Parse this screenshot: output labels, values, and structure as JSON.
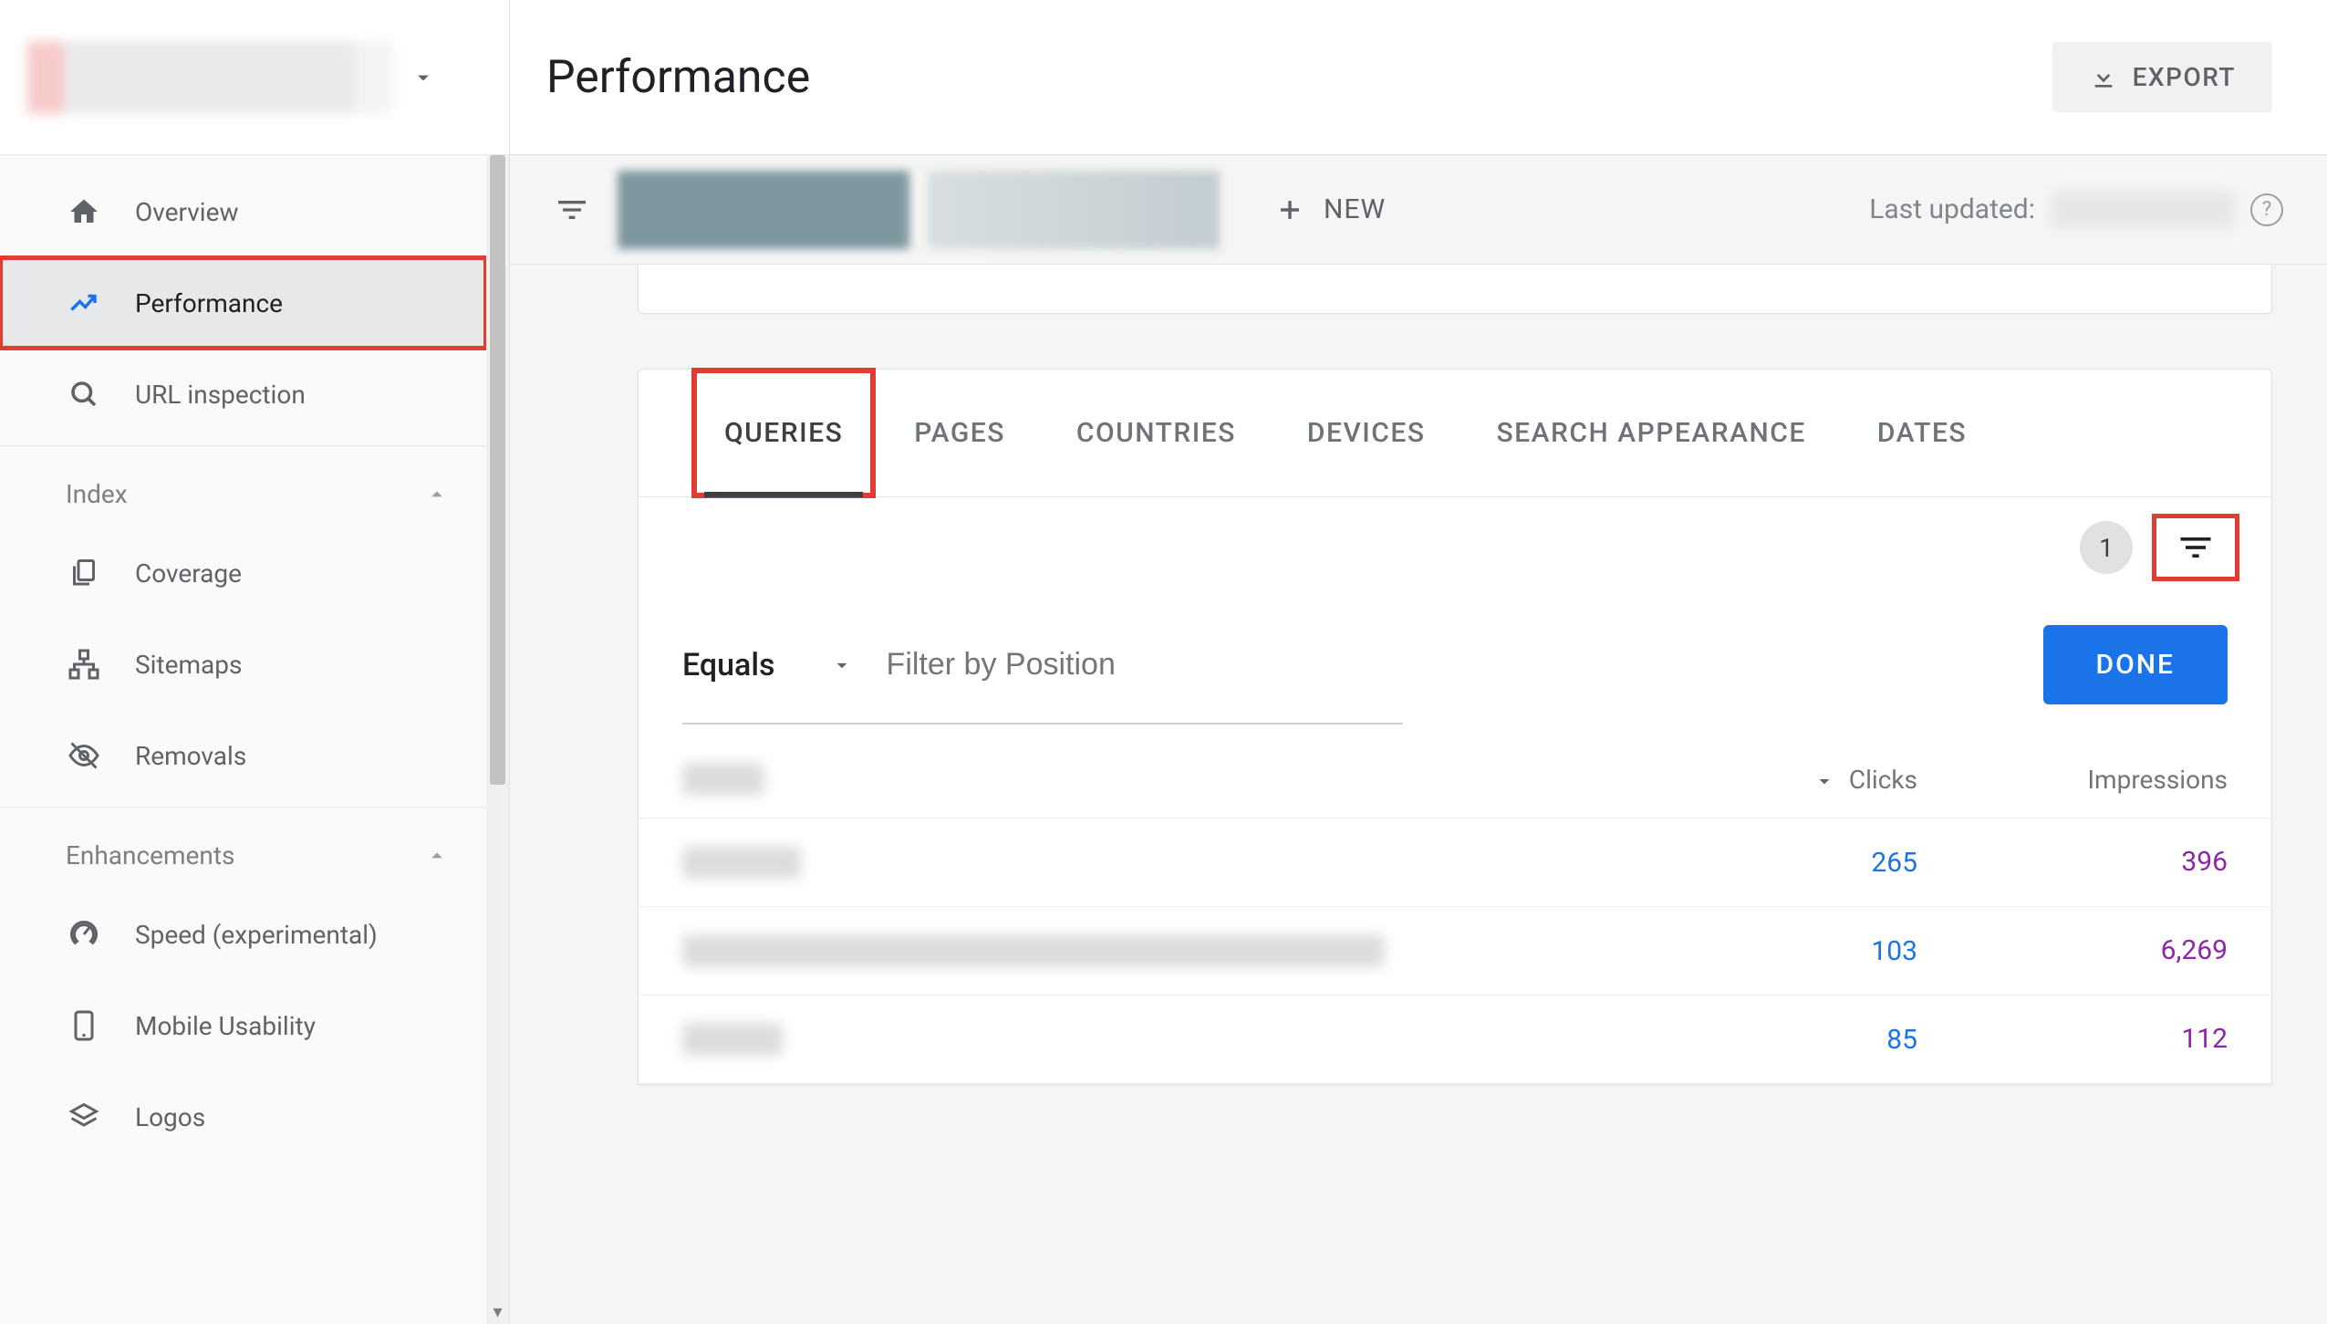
{
  "property_selector": {
    "label": ""
  },
  "sidebar": {
    "items": [
      {
        "label": "Overview",
        "icon": "home"
      },
      {
        "label": "Performance",
        "icon": "trend",
        "active": true,
        "highlight_red": true
      },
      {
        "label": "URL inspection",
        "icon": "search"
      }
    ],
    "section_index": {
      "title": "Index"
    },
    "index_items": [
      {
        "label": "Coverage",
        "icon": "copy"
      },
      {
        "label": "Sitemaps",
        "icon": "sitemap"
      },
      {
        "label": "Removals",
        "icon": "eye-off"
      }
    ],
    "section_enhancements": {
      "title": "Enhancements"
    },
    "enh_items": [
      {
        "label": "Speed (experimental)",
        "icon": "gauge"
      },
      {
        "label": "Mobile Usability",
        "icon": "phone"
      },
      {
        "label": "Logos",
        "icon": "layers"
      }
    ]
  },
  "header": {
    "title": "Performance",
    "export_label": "EXPORT"
  },
  "filterbar": {
    "new_label": "NEW",
    "last_updated_prefix": "Last updated:"
  },
  "tabs": [
    {
      "label": "QUERIES",
      "active": true,
      "highlight_red": true
    },
    {
      "label": "PAGES"
    },
    {
      "label": "COUNTRIES"
    },
    {
      "label": "DEVICES"
    },
    {
      "label": "SEARCH APPEARANCE"
    },
    {
      "label": "DATES"
    }
  ],
  "filter_count": "1",
  "position_filter": {
    "operator": "Equals",
    "placeholder": "Filter by Position",
    "done_label": "DONE"
  },
  "table": {
    "columns": {
      "clicks": "Clicks",
      "impressions": "Impressions"
    },
    "sort": {
      "column": "clicks",
      "direction": "desc"
    },
    "rows": [
      {
        "query": "",
        "clicks": "265",
        "impressions": "396"
      },
      {
        "query": "",
        "clicks": "103",
        "impressions": "6,269"
      },
      {
        "query": "",
        "clicks": "85",
        "impressions": "112"
      }
    ]
  }
}
